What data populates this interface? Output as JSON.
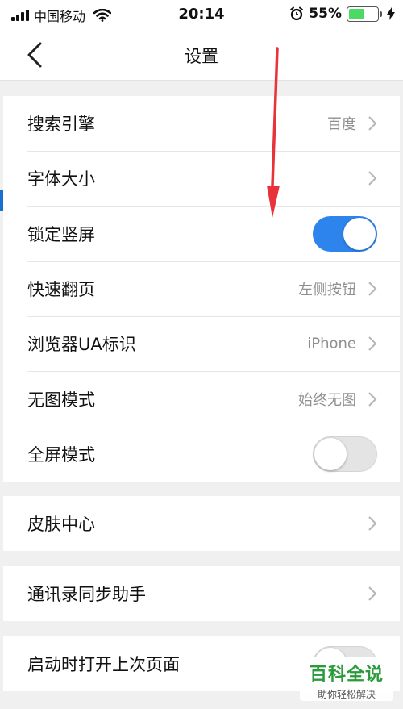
{
  "status_bar": {
    "carrier": "中国移动",
    "time": "20:14",
    "battery": "55%"
  },
  "header": {
    "title": "设置"
  },
  "settings": {
    "search_engine": {
      "label": "搜索引擎",
      "value": "百度"
    },
    "font_size": {
      "label": "字体大小"
    },
    "lock_portrait": {
      "label": "锁定竖屏",
      "enabled": true
    },
    "fast_page_turn": {
      "label": "快速翻页",
      "value": "左侧按钮"
    },
    "browser_ua": {
      "label": "浏览器UA标识",
      "value": "iPhone"
    },
    "no_image_mode": {
      "label": "无图模式",
      "value": "始终无图"
    },
    "fullscreen_mode": {
      "label": "全屏模式",
      "enabled": false
    },
    "skin_center": {
      "label": "皮肤中心"
    },
    "contacts_sync": {
      "label": "通讯录同步助手"
    },
    "open_last_page": {
      "label": "启动时打开上次页面",
      "enabled": false
    }
  },
  "watermark": {
    "title": "百科全说",
    "subtitle": "助你轻松解决"
  },
  "colors": {
    "toggle_on": "#2d84ed",
    "toggle_off": "#e4e4e4",
    "annotation_arrow": "#e8333a",
    "watermark_green": "#2a9a3a",
    "battery_green": "#4cd964"
  }
}
